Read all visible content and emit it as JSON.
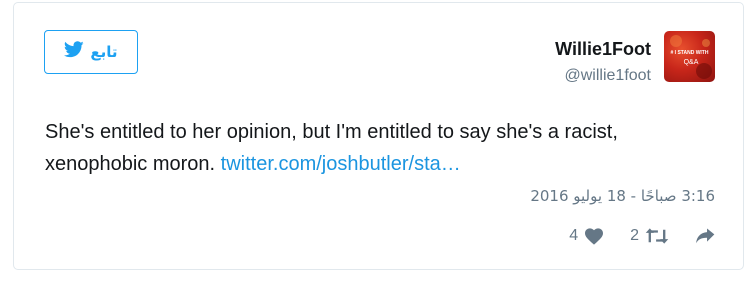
{
  "follow_button": {
    "label": "تابع",
    "icon": "twitter-bird-icon"
  },
  "author": {
    "display_name": "Willie1Foot",
    "screen_name": "@willie1foot",
    "avatar_text": [
      "# I STAND WITH",
      "Q&A"
    ]
  },
  "tweet": {
    "text": "She's entitled to her opinion, but I'm entitled to say she's a racist, xenophobic moron. ",
    "link_text": "twitter.com/joshbutler/sta…",
    "timestamp": "3:16 صباحًا - 18 يوليو 2016"
  },
  "actions": {
    "share": {
      "icon": "share-arrow-icon"
    },
    "retweets": {
      "count": "2",
      "icon": "retweet-icon"
    },
    "likes": {
      "count": "4",
      "icon": "heart-icon"
    }
  },
  "colors": {
    "accent": "#1da1f2",
    "link": "#1b95e0",
    "muted": "#657786",
    "border": "#e1e8ed"
  }
}
